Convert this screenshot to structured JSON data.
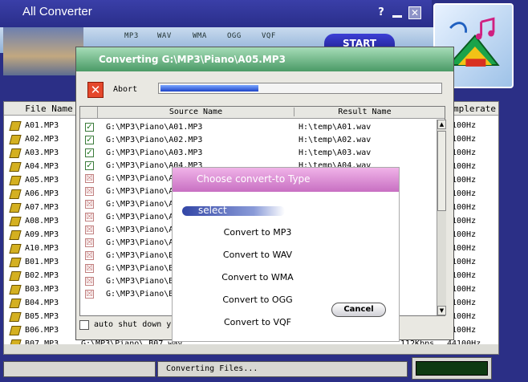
{
  "app": {
    "title": "All Converter"
  },
  "window_controls": {
    "help": "?",
    "close": "✕"
  },
  "toolbar": {
    "formats": [
      "MP3",
      "WAV",
      "WMA",
      "OGG",
      "VQF"
    ],
    "start_label": "START"
  },
  "main_list": {
    "columns": {
      "file_name": "File Name",
      "samplerate": "mplerate"
    },
    "rows": [
      {
        "file": "A01.MP3",
        "rate": "100Hz"
      },
      {
        "file": "A02.MP3",
        "rate": "100Hz"
      },
      {
        "file": "A03.MP3",
        "rate": "100Hz"
      },
      {
        "file": "A04.MP3",
        "rate": "100Hz"
      },
      {
        "file": "A05.MP3",
        "rate": "100Hz"
      },
      {
        "file": "A06.MP3",
        "rate": "100Hz"
      },
      {
        "file": "A07.MP3",
        "rate": "100Hz"
      },
      {
        "file": "A08.MP3",
        "rate": "100Hz"
      },
      {
        "file": "A09.MP3",
        "rate": "100Hz"
      },
      {
        "file": "A10.MP3",
        "rate": "100Hz"
      },
      {
        "file": "B01.MP3",
        "rate": "100Hz"
      },
      {
        "file": "B02.MP3",
        "rate": "100Hz"
      },
      {
        "file": "B03.MP3",
        "rate": "100Hz"
      },
      {
        "file": "B04.MP3",
        "rate": "100Hz"
      },
      {
        "file": "B05.MP3",
        "rate": "100Hz"
      },
      {
        "file": "B06.MP3",
        "rate": "100Hz"
      }
    ],
    "bottom_row": {
      "file": "B07.MP3",
      "source": "G:\\MP3\\Piano\\  B07.wav",
      "bitrate": "112Kbps",
      "rate": "44100Hz"
    }
  },
  "converting_dialog": {
    "title": "Converting G:\\MP3\\Piano\\A05.MP3",
    "abort_label": "Abort",
    "progress": 0.35,
    "columns": {
      "source": "Source Name",
      "result": "Result Name"
    },
    "rows": [
      {
        "checked": true,
        "source": "G:\\MP3\\Piano\\A01.MP3",
        "result": "H:\\temp\\A01.wav"
      },
      {
        "checked": true,
        "source": "G:\\MP3\\Piano\\A02.MP3",
        "result": "H:\\temp\\A02.wav"
      },
      {
        "checked": true,
        "source": "G:\\MP3\\Piano\\A03.MP3",
        "result": "H:\\temp\\A03.wav"
      },
      {
        "checked": true,
        "source": "G:\\MP3\\Piano\\A04.MP3",
        "result": "H:\\temp\\A04.wav"
      },
      {
        "checked": false,
        "source": "G:\\MP3\\Piano\\A",
        "result": ""
      },
      {
        "checked": false,
        "source": "G:\\MP3\\Piano\\A",
        "result": ""
      },
      {
        "checked": false,
        "source": "G:\\MP3\\Piano\\A",
        "result": ""
      },
      {
        "checked": false,
        "source": "G:\\MP3\\Piano\\A",
        "result": ""
      },
      {
        "checked": false,
        "source": "G:\\MP3\\Piano\\A",
        "result": ""
      },
      {
        "checked": false,
        "source": "G:\\MP3\\Piano\\A",
        "result": ""
      },
      {
        "checked": false,
        "source": "G:\\MP3\\Piano\\B",
        "result": ""
      },
      {
        "checked": false,
        "source": "G:\\MP3\\Piano\\B",
        "result": ""
      },
      {
        "checked": false,
        "source": "G:\\MP3\\Piano\\B",
        "result": ""
      },
      {
        "checked": false,
        "source": "G:\\MP3\\Piano\\B",
        "result": ""
      }
    ],
    "auto_shutdown_label": "auto shut down yo"
  },
  "type_popup": {
    "title": "Choose convert-to Type",
    "select_label": "select",
    "options": [
      "Convert to MP3",
      "Convert to WAV",
      "Convert to WMA",
      "Convert to OGG",
      "Convert to VQF"
    ],
    "cancel_label": "Cancel"
  },
  "status": {
    "text": "Converting Files..."
  }
}
